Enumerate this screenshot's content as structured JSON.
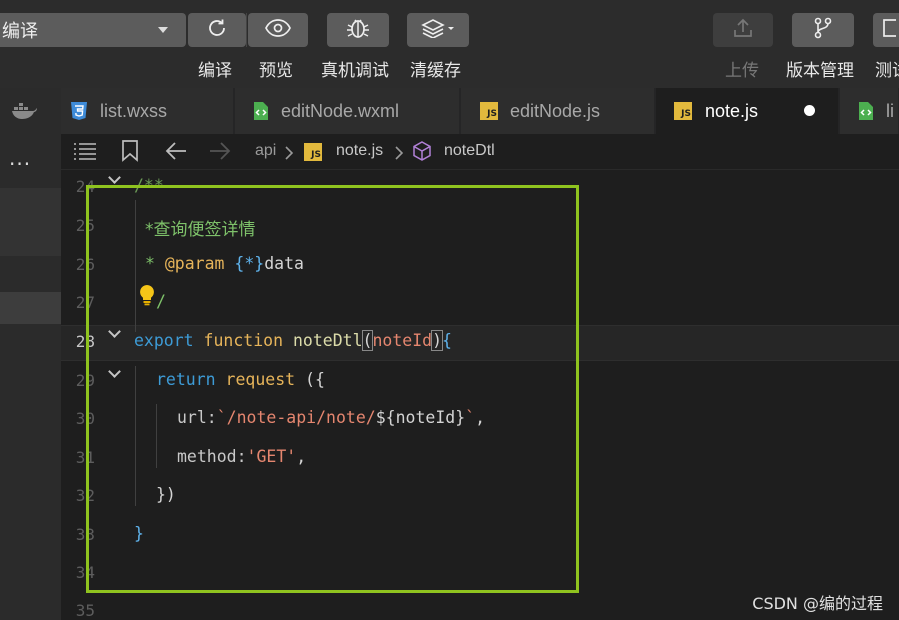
{
  "toolbar": {
    "compile_select": "编译",
    "buttons": [
      {
        "label": "编译",
        "icon": "refresh-icon"
      },
      {
        "label": "预览",
        "icon": "eye-icon"
      },
      {
        "label": "真机调试",
        "icon": "bug-icon"
      },
      {
        "label": "清缓存",
        "icon": "layers-icon"
      },
      {
        "label": "上传",
        "icon": "upload-icon"
      },
      {
        "label": "版本管理",
        "icon": "branch-icon"
      },
      {
        "label": "测试",
        "icon": "test-icon"
      }
    ]
  },
  "activity": {
    "more": "···"
  },
  "tabs": [
    {
      "label": "list.wxss",
      "icon": "css-file-icon"
    },
    {
      "label": "editNode.wxml",
      "icon": "wxml-file-icon"
    },
    {
      "label": "editNode.js",
      "icon": "js-file-icon"
    },
    {
      "label": "note.js",
      "icon": "js-file-icon",
      "active": true,
      "modified": true
    },
    {
      "label": "li",
      "icon": "wxml-file-icon"
    }
  ],
  "breadcrumb": {
    "folder": "api",
    "file": "note.js",
    "symbol": "noteDtl"
  },
  "editor": {
    "line_numbers": [
      "24",
      "25",
      "26",
      "27",
      "28",
      "29",
      "30",
      "31",
      "32",
      "33",
      "34",
      "35"
    ],
    "current_line": "28",
    "code": {
      "l24": "/**",
      "l25": "*查询便签详情",
      "l26_star": "* ",
      "l26_tag": "@param",
      "l26_type": "{*}",
      "l26_name": "data",
      "l27": "/",
      "l28_export": "export",
      "l28_function": "function",
      "l28_name": "noteDtl",
      "l28_open": "(",
      "l28_param": "noteId",
      "l28_close": ")",
      "l28_brace": "{",
      "l29_return": "return",
      "l29_call": "request",
      "l29_open": " ({",
      "l30_key": "url:",
      "l30_str": "`/note-api/note/",
      "l30_interp_open": "${",
      "l30_interp_var": "noteId",
      "l30_interp_close": "}",
      "l30_tick": "`",
      "l30_comma": ",",
      "l31_key": "method:",
      "l31_str": "'GET'",
      "l31_comma": ",",
      "l32": "})",
      "l33": "}"
    }
  },
  "watermark": "CSDN @编的过程",
  "colors": {
    "highlight_box": "#8fc31f",
    "comment": "#6a9955",
    "keyword": "#3d9bd6",
    "function": "#dcdcaa",
    "string": "#e5866f"
  }
}
